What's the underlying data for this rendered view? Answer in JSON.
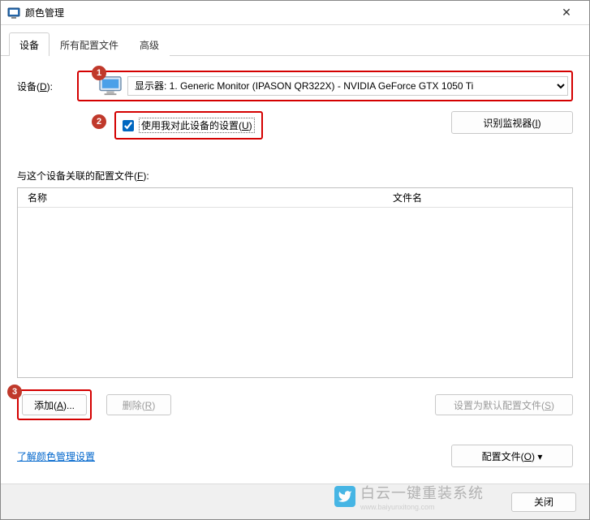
{
  "window": {
    "title": "颜色管理",
    "close_glyph": "✕"
  },
  "tabs": {
    "device": "设备",
    "all_profiles": "所有配置文件",
    "advanced": "高级"
  },
  "device_panel": {
    "device_label_pre": "设备(",
    "device_label_u": "D",
    "device_label_post": "):",
    "selected_device": "显示器: 1. Generic Monitor (IPASON QR322X) - NVIDIA GeForce GTX 1050 Ti",
    "use_settings_pre": "使用我对此设备的设置(",
    "use_settings_u": "U",
    "use_settings_post": ")",
    "use_settings_checked": true,
    "identify_label_pre": "识别监视器(",
    "identify_label_u": "I",
    "identify_label_post": ")",
    "profiles_assoc_pre": "与这个设备关联的配置文件(",
    "profiles_assoc_u": "F",
    "profiles_assoc_post": "):",
    "col_name": "名称",
    "col_file": "文件名",
    "add_label_pre": "添加(",
    "add_label_u": "A",
    "add_label_post": ")...",
    "remove_label_pre": "删除(",
    "remove_label_u": "R",
    "remove_label_post": ")",
    "default_label_pre": "设置为默认配置文件(",
    "default_label_u": "S",
    "default_label_post": ")",
    "learn_link": "了解颜色管理设置",
    "profiles_btn_pre": "配置文件(",
    "profiles_btn_u": "O",
    "profiles_btn_post": ")"
  },
  "footer": {
    "close": "关闭"
  },
  "annotations": {
    "b1": "1",
    "b2": "2",
    "b3": "3"
  },
  "watermark": {
    "main": "白云一键重装系统",
    "sub": "www.baiyunxitong.com"
  }
}
